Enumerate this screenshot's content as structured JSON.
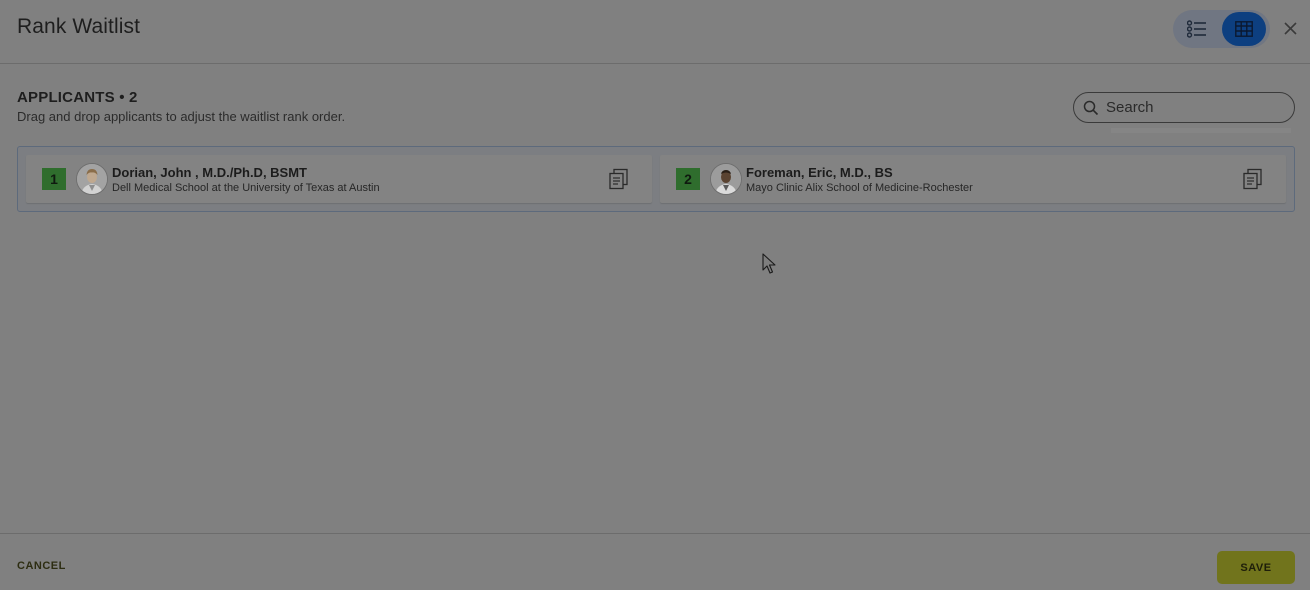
{
  "header": {
    "title": "Rank Waitlist",
    "view_toggle": {
      "list_icon": "list-icon",
      "grid_icon": "grid-icon",
      "active": "grid"
    },
    "close_icon": "close-icon"
  },
  "applicants": {
    "heading": "APPLICANTS • 2",
    "instructions": "Drag and drop applicants to adjust the waitlist rank order.",
    "search": {
      "placeholder": "Search",
      "value": ""
    },
    "items": [
      {
        "rank": "1",
        "name": "Dorian, John , M.D./Ph.D, BSMT",
        "school": "Dell Medical School at the University of Texas at Austin",
        "icon": "document-icon"
      },
      {
        "rank": "2",
        "name": "Foreman, Eric, M.D., BS",
        "school": "Mayo Clinic Alix School of Medicine-Rochester",
        "icon": "document-icon"
      }
    ]
  },
  "footer": {
    "cancel_label": "CANCEL",
    "save_label": "SAVE"
  },
  "colors": {
    "overlay": "#808080",
    "rank_badge": "#2f6d2d",
    "active_toggle": "#0d3f80",
    "save_button": "#71741c"
  }
}
